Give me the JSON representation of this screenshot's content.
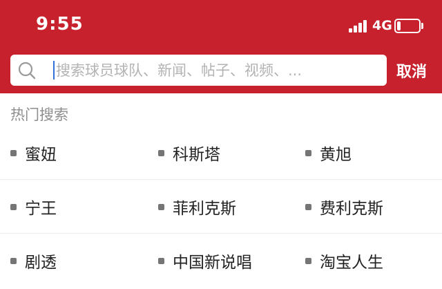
{
  "status_bar": {
    "time": "9:55",
    "network": "4G",
    "battery_level": 0.18
  },
  "search": {
    "placeholder": "搜索球员球队、新闻、帖子、视频、..."
  },
  "cancel_label": "取消",
  "hot_search": {
    "title": "热门搜索",
    "rows": [
      [
        "蜜妞",
        "科斯塔",
        "黄旭"
      ],
      [
        "宁王",
        "菲利克斯",
        "费利克斯"
      ],
      [
        "剧透",
        "中国新说唱",
        "淘宝人生"
      ]
    ]
  },
  "colors": {
    "header_red": "#c8212e",
    "text_gray": "#8e8e8e",
    "cursor_blue": "#2f6fd6"
  }
}
